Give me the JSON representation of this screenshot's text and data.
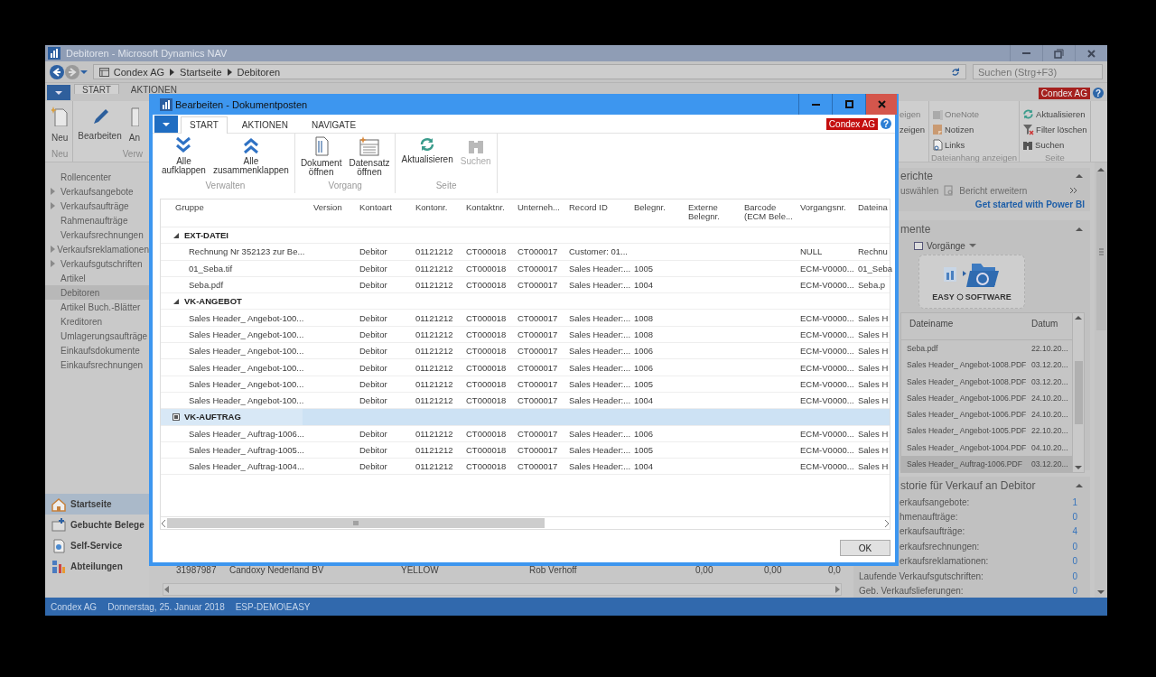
{
  "main_window": {
    "title": "Debitoren - Microsoft Dynamics NAV",
    "breadcrumb": [
      "Condex AG",
      "Startseite",
      "Debitoren"
    ],
    "search": {
      "placeholder": "Suchen (Strg+F3)"
    },
    "tabs": [
      {
        "label": "START",
        "selected": true
      },
      {
        "label": "AKTIONEN",
        "selected": false
      }
    ],
    "company_badge": "Condex AG",
    "help": "?",
    "ribbon_left": [
      {
        "label": "Neu",
        "buttons": [
          {
            "label": "Neu"
          }
        ]
      },
      {
        "label": "Verw",
        "buttons": [
          {
            "label": "Bearbeiten"
          },
          {
            "label": "An"
          }
        ]
      }
    ],
    "ribbon_right": [
      {
        "items": [
          {
            "label": "eigen",
            "disabled": true
          },
          {
            "label": "zeigen",
            "disabled": false
          }
        ]
      },
      {
        "label": "Dateianhang anzeigen",
        "items": [
          {
            "label": "OneNote",
            "disabled": true
          },
          {
            "label": "Notizen",
            "disabled": false
          },
          {
            "label": "Links",
            "disabled": false
          }
        ]
      },
      {
        "label": "Seite",
        "items": [
          {
            "label": "Aktualisieren",
            "disabled": false
          },
          {
            "label": "Filter löschen",
            "disabled": false
          },
          {
            "label": "Suchen",
            "disabled": false
          }
        ]
      }
    ],
    "sidebar": {
      "items": [
        {
          "label": "Rollencenter",
          "has_children": false,
          "selected": false
        },
        {
          "label": "Verkaufsangebote",
          "has_children": true,
          "selected": false
        },
        {
          "label": "Verkaufsaufträge",
          "has_children": true,
          "selected": false
        },
        {
          "label": "Rahmenaufträge",
          "has_children": false,
          "selected": false
        },
        {
          "label": "Verkaufsrechnungen",
          "has_children": false,
          "selected": false
        },
        {
          "label": "Verkaufsreklamationen",
          "has_children": true,
          "selected": false
        },
        {
          "label": "Verkaufsgutschriften",
          "has_children": true,
          "selected": false
        },
        {
          "label": "Artikel",
          "has_children": false,
          "selected": false
        },
        {
          "label": "Debitoren",
          "has_children": false,
          "selected": true
        },
        {
          "label": "Artikel Buch.-Blätter",
          "has_children": false,
          "selected": false
        },
        {
          "label": "Kreditoren",
          "has_children": false,
          "selected": false
        },
        {
          "label": "Umlagerungsaufträge",
          "has_children": false,
          "selected": false
        },
        {
          "label": "Einkaufsdokumente",
          "has_children": false,
          "selected": false
        },
        {
          "label": "Einkaufsrechnungen",
          "has_children": false,
          "selected": false
        }
      ],
      "nav_buttons": [
        {
          "label": "Startseite",
          "selected": true
        },
        {
          "label": "Gebuchte Belege",
          "selected": false
        },
        {
          "label": "Self-Service",
          "selected": false
        },
        {
          "label": "Abteilungen",
          "selected": false
        }
      ]
    },
    "list_row": [
      "31987987",
      "Candoxy Nederland BV",
      "YELLOW",
      "Rob Verhoff",
      "0,00",
      "0,00",
      "0,0"
    ],
    "factbox": {
      "reports": {
        "title": "erichte",
        "actions": [
          "uswählen",
          "Bericht erweitern"
        ],
        "link": "Get started with Power BI"
      },
      "documents": {
        "title": "mente",
        "menu": "Vorgänge",
        "logo": [
          "EASY",
          "SOFTWARE"
        ],
        "columns": [
          "Dateiname",
          "Datum"
        ],
        "files": [
          {
            "name": "Seba.pdf",
            "date": "22.10.20...",
            "selected": false
          },
          {
            "name": "Sales Header_ Angebot-1008.PDF",
            "date": "03.12.20...",
            "selected": false
          },
          {
            "name": "Sales Header_ Angebot-1008.PDF",
            "date": "03.12.20...",
            "selected": false
          },
          {
            "name": "Sales Header_ Angebot-1006.PDF",
            "date": "24.10.20...",
            "selected": false
          },
          {
            "name": "Sales Header_ Angebot-1006.PDF",
            "date": "24.10.20...",
            "selected": false
          },
          {
            "name": "Sales Header_ Angebot-1005.PDF",
            "date": "22.10.20...",
            "selected": false
          },
          {
            "name": "Sales Header_ Angebot-1004.PDF",
            "date": "04.10.20...",
            "selected": false
          },
          {
            "name": "Sales Header_ Auftrag-1006.PDF",
            "date": "03.12.20...",
            "selected": true
          }
        ]
      },
      "history": {
        "title": "storie für Verkauf an Debitor",
        "rows": [
          {
            "label": "erkaufsangebote:",
            "value": "1"
          },
          {
            "label": "hmenaufträge:",
            "value": "0"
          },
          {
            "label": "erkaufsaufträge:",
            "value": "4"
          },
          {
            "label": "erkaufsrechnungen:",
            "value": "0"
          },
          {
            "label": "erkaufsreklamationen:",
            "value": "0"
          },
          {
            "label": "Laufende Verkaufsgutschriften:",
            "value": "0"
          },
          {
            "label": "Geb. Verkaufslieferungen:",
            "value": "0"
          }
        ]
      }
    },
    "status_bar": [
      "Condex AG",
      "Donnerstag, 25. Januar 2018",
      "ESP-DEMO\\EASY"
    ]
  },
  "dialog": {
    "title": "Bearbeiten - Dokumentposten",
    "tabs": [
      {
        "label": "START",
        "selected": true
      },
      {
        "label": "AKTIONEN",
        "selected": false
      },
      {
        "label": "NAVIGATE",
        "selected": false
      }
    ],
    "company_badge": "Condex AG",
    "help": "?",
    "ribbon_groups": [
      {
        "label": "Verwalten",
        "buttons": [
          {
            "label": "Alle aufklappen",
            "disabled": false
          },
          {
            "label": "Alle zusammenklappen",
            "disabled": false
          }
        ]
      },
      {
        "label": "Vorgang",
        "buttons": [
          {
            "label": "Dokument öffnen",
            "disabled": false
          },
          {
            "label": "Datensatz öffnen",
            "disabled": false
          }
        ]
      },
      {
        "label": "Seite",
        "buttons": [
          {
            "label": "Aktualisieren",
            "disabled": false
          },
          {
            "label": "Suchen",
            "disabled": true
          }
        ]
      }
    ],
    "table": {
      "columns": [
        "Gruppe",
        "Version",
        "Kontoart",
        "Kontonr.",
        "Kontaktnr.",
        "Unterneh...",
        "Record ID",
        "Belegnr.",
        "Externe Belegnr.",
        "Barcode (ECM Bele...",
        "Vorgangsnr.",
        "Dateina"
      ],
      "groups": [
        {
          "name": "EXT-DATEI",
          "expanded": true,
          "selected": false,
          "rows": [
            {
              "gruppe": "Rechnung Nr  352123 zur Be...",
              "kontoart": "Debitor",
              "kontonr": "01121212",
              "kontaktnr": "CT000018",
              "unternehmen": "CT000017",
              "record_id": "Customer: 01...",
              "vorgangsnr": "NULL",
              "dateiname": "Rechnu"
            },
            {
              "gruppe": "01_Seba.tif",
              "kontoart": "Debitor",
              "kontonr": "01121212",
              "kontaktnr": "CT000018",
              "unternehmen": "CT000017",
              "record_id": "Sales Header:...",
              "belegnr": "1005",
              "vorgangsnr": "ECM-V0000...",
              "dateiname": "01_Seba"
            },
            {
              "gruppe": "Seba.pdf",
              "kontoart": "Debitor",
              "kontonr": "01121212",
              "kontaktnr": "CT000018",
              "unternehmen": "CT000017",
              "record_id": "Sales Header:...",
              "belegnr": "1004",
              "vorgangsnr": "ECM-V0000...",
              "dateiname": "Seba.p"
            }
          ]
        },
        {
          "name": "VK-ANGEBOT",
          "expanded": true,
          "selected": false,
          "rows": [
            {
              "gruppe": "Sales Header_ Angebot-100...",
              "kontoart": "Debitor",
              "kontonr": "01121212",
              "kontaktnr": "CT000018",
              "unternehmen": "CT000017",
              "record_id": "Sales Header:...",
              "belegnr": "1008",
              "vorgangsnr": "ECM-V0000...",
              "dateiname": "Sales H"
            },
            {
              "gruppe": "Sales Header_ Angebot-100...",
              "kontoart": "Debitor",
              "kontonr": "01121212",
              "kontaktnr": "CT000018",
              "unternehmen": "CT000017",
              "record_id": "Sales Header:...",
              "belegnr": "1008",
              "vorgangsnr": "ECM-V0000...",
              "dateiname": "Sales H"
            },
            {
              "gruppe": "Sales Header_ Angebot-100...",
              "kontoart": "Debitor",
              "kontonr": "01121212",
              "kontaktnr": "CT000018",
              "unternehmen": "CT000017",
              "record_id": "Sales Header:...",
              "belegnr": "1006",
              "vorgangsnr": "ECM-V0000...",
              "dateiname": "Sales H"
            },
            {
              "gruppe": "Sales Header_ Angebot-100...",
              "kontoart": "Debitor",
              "kontonr": "01121212",
              "kontaktnr": "CT000018",
              "unternehmen": "CT000017",
              "record_id": "Sales Header:...",
              "belegnr": "1006",
              "vorgangsnr": "ECM-V0000...",
              "dateiname": "Sales H"
            },
            {
              "gruppe": "Sales Header_ Angebot-100...",
              "kontoart": "Debitor",
              "kontonr": "01121212",
              "kontaktnr": "CT000018",
              "unternehmen": "CT000017",
              "record_id": "Sales Header:...",
              "belegnr": "1005",
              "vorgangsnr": "ECM-V0000...",
              "dateiname": "Sales H"
            },
            {
              "gruppe": "Sales Header_ Angebot-100...",
              "kontoart": "Debitor",
              "kontonr": "01121212",
              "kontaktnr": "CT000018",
              "unternehmen": "CT000017",
              "record_id": "Sales Header:...",
              "belegnr": "1004",
              "vorgangsnr": "ECM-V0000...",
              "dateiname": "Sales H"
            }
          ]
        },
        {
          "name": "VK-AUFTRAG",
          "expanded": true,
          "selected": true,
          "rows": [
            {
              "gruppe": "Sales Header_ Auftrag-1006...",
              "kontoart": "Debitor",
              "kontonr": "01121212",
              "kontaktnr": "CT000018",
              "unternehmen": "CT000017",
              "record_id": "Sales Header:...",
              "belegnr": "1006",
              "vorgangsnr": "ECM-V0000...",
              "dateiname": "Sales H"
            },
            {
              "gruppe": "Sales Header_ Auftrag-1005...",
              "kontoart": "Debitor",
              "kontonr": "01121212",
              "kontaktnr": "CT000018",
              "unternehmen": "CT000017",
              "record_id": "Sales Header:...",
              "belegnr": "1005",
              "vorgangsnr": "ECM-V0000...",
              "dateiname": "Sales H"
            },
            {
              "gruppe": "Sales Header_ Auftrag-1004...",
              "kontoart": "Debitor",
              "kontonr": "01121212",
              "kontaktnr": "CT000018",
              "unternehmen": "CT000017",
              "record_id": "Sales Header:...",
              "belegnr": "1004",
              "vorgangsnr": "ECM-V0000...",
              "dateiname": "Sales H"
            }
          ]
        }
      ]
    },
    "ok_button": "OK"
  }
}
